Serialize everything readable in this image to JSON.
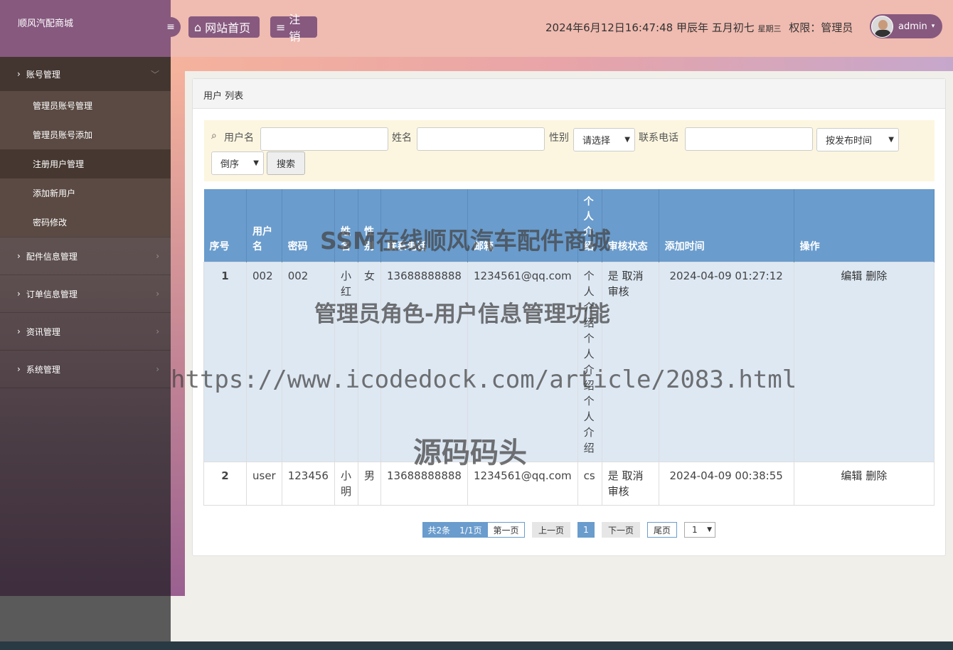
{
  "sidebar": {
    "brand": "顺风汽配商城",
    "groups": [
      {
        "label": "账号管理",
        "items": [
          "管理员账号管理",
          "管理员账号添加",
          "注册用户管理",
          "添加新用户",
          "密码修改"
        ]
      },
      {
        "label": "配件信息管理"
      },
      {
        "label": "订单信息管理"
      },
      {
        "label": "资讯管理"
      },
      {
        "label": "系统管理"
      }
    ]
  },
  "header": {
    "home_label": "网站首页",
    "logout_label": "注销",
    "datetime": "2024年6月12日16:47:48 甲辰年 五月初七",
    "weekday": "星期三",
    "role": "权限：管理员",
    "username": "admin"
  },
  "panel": {
    "title": "用户 列表",
    "filter": {
      "username_label": "用户名",
      "name_label": "姓名",
      "gender_label": "性别",
      "gender_value": "请选择",
      "phone_label": "联系电话",
      "sort_field": "按发布时间",
      "sort_order": "倒序",
      "search_label": "搜索"
    },
    "table": {
      "headers": [
        "序号",
        "用户名",
        "密码",
        "姓名",
        "性别",
        "联系电话",
        "邮箱",
        "个人介绍",
        "审核状态",
        "添加时间",
        "操作"
      ],
      "rows": [
        {
          "no": "1",
          "username": "002",
          "password": "002",
          "name": "小红",
          "gender": "女",
          "phone": "13688888888",
          "email": "1234561@qq.com",
          "intro": "个人介绍个人介绍个人介绍",
          "status": "是",
          "status_action": "取消审核",
          "time": "2024-04-09 01:27:12",
          "edit": "编辑",
          "delete": "删除"
        },
        {
          "no": "2",
          "username": "user",
          "password": "123456",
          "name": "小明",
          "gender": "男",
          "phone": "13688888888",
          "email": "1234561@qq.com",
          "intro": "cs",
          "status": "是",
          "status_action": "取消审核",
          "time": "2024-04-09 00:38:55",
          "edit": "编辑",
          "delete": "删除"
        }
      ]
    },
    "pagination": {
      "total": "共2条",
      "pages": "1/1页",
      "first": "第一页",
      "prev": "上一页",
      "current": "1",
      "next": "下一页",
      "last": "尾页",
      "jump_value": "1"
    }
  },
  "watermarks": {
    "line1": "SSM在线顺风汽车配件商城",
    "line2": "管理员角色-用户信息管理功能",
    "line3": "https://www.icodedock.com/article/2083.html",
    "line4": "源码码头"
  },
  "colors": {
    "primary": "#87597f",
    "header_bg": "#f0bbb0",
    "table_head": "#6a9ccd",
    "filter_bg": "#fcf6e0"
  }
}
